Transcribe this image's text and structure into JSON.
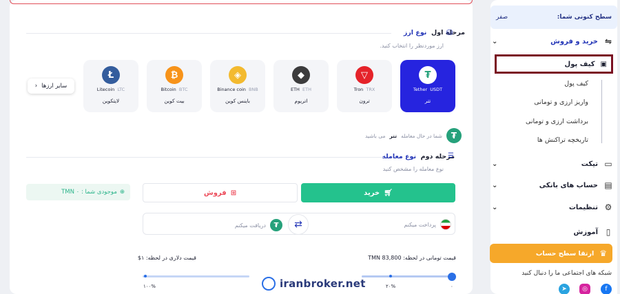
{
  "sidebar": {
    "level_label": "سطح کنونی شما:",
    "level_value": "صفر",
    "items": [
      {
        "label": "خرید و فروش",
        "icon": "exchange-icon",
        "expanded": true
      },
      {
        "label": "کیف پول",
        "icon": "wallet-icon"
      },
      {
        "label": "تیکت",
        "icon": "ticket-icon"
      },
      {
        "label": "حساب های بانکی",
        "icon": "bank-card-icon"
      },
      {
        "label": "تنظیمات",
        "icon": "gear-icon"
      },
      {
        "label": "آموزش",
        "icon": "book-icon"
      }
    ],
    "wallet_sub": [
      "کیف پول",
      "واریز ارزی و تومانی",
      "برداشت ارزی و تومانی",
      "تاریخچه تراکنش ها"
    ],
    "upgrade_label": "ارتقا سطح حساب",
    "social_title": "شبکه های اجتماعی ما را دنبال کنید",
    "social_icons": [
      "facebook-icon",
      "instagram-icon",
      "telegram-icon"
    ]
  },
  "step1": {
    "prefix": "مرحله اول",
    "title": "نوع ارز",
    "subtitle": "ارز موردنظر را انتخاب کنید."
  },
  "coins": [
    {
      "en": "Tether",
      "sym": "USDT",
      "fa": "تتر",
      "color": "#26a17b",
      "glyph": "₮",
      "selected": true
    },
    {
      "en": "Tron",
      "sym": "TRX",
      "fa": "ترون",
      "color": "#e5232a",
      "glyph": "▽",
      "selected": false
    },
    {
      "en": "ETH",
      "sym": "ETH",
      "fa": "اتریوم",
      "color": "#3c3c3d",
      "glyph": "◆",
      "selected": false
    },
    {
      "en": "Binance coin",
      "sym": "BNB",
      "fa": "باینس کوین",
      "color": "#f3ba2f",
      "glyph": "◈",
      "selected": false
    },
    {
      "en": "Bitcoin",
      "sym": "BTC",
      "fa": "بیت کوین",
      "color": "#f7931a",
      "glyph": "₿",
      "selected": false
    },
    {
      "en": "Litecoin",
      "sym": "LTC",
      "fa": "لایتکوین",
      "color": "#345d9d",
      "glyph": "Ł",
      "selected": false
    }
  ],
  "other_coins_label": "سایر ارزها",
  "trading": {
    "prefix": "شما در حال معامله",
    "coin": "تتر",
    "suffix": "می باشید"
  },
  "step2": {
    "prefix": "مرحله دوم",
    "title": "نوع معامله",
    "subtitle": "نوع معامله را مشخص کنید"
  },
  "balance_label": "موجودی شما : TMN ۰",
  "buy_label": "خرید",
  "sell_label": "فروش",
  "pay_label": "پرداخت میکنم",
  "receive_label": "دریافت میکنم",
  "price_toman": "قیمت تومانی در لحظه: TMN 83,800",
  "price_dollar": "قیمت دلاری در لحظه: ۱$",
  "slider": {
    "value_percent": 0,
    "ticks": [
      "۰",
      "۲۰%",
      "۱۰۰%"
    ]
  },
  "watermark": "iranbroker.net"
}
